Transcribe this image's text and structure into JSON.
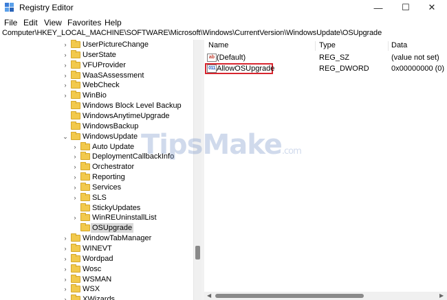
{
  "window": {
    "title": "Registry Editor",
    "minimize_glyph": "—",
    "maximize_glyph": "☐",
    "close_glyph": "✕"
  },
  "menu": {
    "file": "File",
    "edit": "Edit",
    "view": "View",
    "favorites": "Favorites",
    "help": "Help"
  },
  "address": {
    "path": "Computer\\HKEY_LOCAL_MACHINE\\SOFTWARE\\Microsoft\\Windows\\CurrentVersion\\WindowsUpdate\\OSUpgrade"
  },
  "tree": {
    "items": [
      {
        "label": "UserPictureChange",
        "expandable": true
      },
      {
        "label": "UserState",
        "expandable": true
      },
      {
        "label": "VFUProvider",
        "expandable": true
      },
      {
        "label": "WaaSAssessment",
        "expandable": true
      },
      {
        "label": "WebCheck",
        "expandable": true
      },
      {
        "label": "WinBio",
        "expandable": true
      },
      {
        "label": "Windows Block Level Backup",
        "expandable": false
      },
      {
        "label": "WindowsAnytimeUpgrade",
        "expandable": false
      },
      {
        "label": "WindowsBackup",
        "expandable": false
      },
      {
        "label": "WindowsUpdate",
        "expandable": true,
        "expanded": true
      },
      {
        "label": "Auto Update",
        "expandable": true
      },
      {
        "label": "DeploymentCallbackInfo",
        "expandable": true
      },
      {
        "label": "Orchestrator",
        "expandable": true
      },
      {
        "label": "Reporting",
        "expandable": true
      },
      {
        "label": "Services",
        "expandable": true
      },
      {
        "label": "SLS",
        "expandable": true
      },
      {
        "label": "StickyUpdates",
        "expandable": false
      },
      {
        "label": "WinREUninstallList",
        "expandable": true
      },
      {
        "label": "OSUpgrade",
        "expandable": false,
        "selected": true
      },
      {
        "label": "WindowTabManager",
        "expandable": true
      },
      {
        "label": "WINEVT",
        "expandable": true
      },
      {
        "label": "Wordpad",
        "expandable": true
      },
      {
        "label": "Wosc",
        "expandable": true
      },
      {
        "label": "WSMAN",
        "expandable": true
      },
      {
        "label": "WSX",
        "expandable": true
      },
      {
        "label": "XWizards",
        "expandable": true
      }
    ]
  },
  "list": {
    "headers": {
      "name": "Name",
      "type": "Type",
      "data": "Data"
    },
    "rows": [
      {
        "name": "(Default)",
        "type": "REG_SZ",
        "data": "(value not set)",
        "icon": "string-value-icon",
        "icon_glyph": "ab"
      },
      {
        "name": "AllowOSUpgrade",
        "type": "REG_DWORD",
        "data": "0x00000000 (0)",
        "icon": "binary-value-icon",
        "icon_glyph": "011"
      }
    ]
  },
  "watermark": {
    "brand": "TipsMake",
    "suffix": ".com"
  },
  "colors": {
    "highlight_border": "#d7242e",
    "folder": "#f2c94c",
    "selection": "#d9d9d9"
  }
}
